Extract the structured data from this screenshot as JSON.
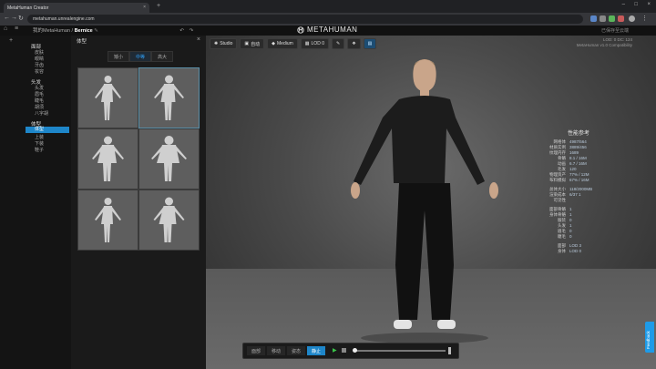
{
  "browser": {
    "tab_title": "MetaHuman Creator",
    "url": "metahuman.unrealengine.com",
    "close_glyph": "×",
    "new_tab_glyph": "+",
    "window_controls": [
      "–",
      "□",
      "×"
    ]
  },
  "header": {
    "breadcrumb_root": "我的MetaHuman",
    "breadcrumb_sep": "/",
    "character_name": "Bernice",
    "logo_text": "METAHUMAN",
    "undo_glyph": "↶",
    "redo_glyph": "↷",
    "right_text": "已保存至云端"
  },
  "leftnav": {
    "groups": [
      {
        "label": "面部",
        "items": [
          "皮肤",
          "眼睛",
          "牙齿",
          "妆容"
        ]
      },
      {
        "label": "头发",
        "items": [
          "头发",
          "眉毛",
          "睫毛",
          "胡须",
          "八字胡"
        ]
      },
      {
        "label": "体型",
        "items": [
          "体型",
          "上装",
          "下装",
          "鞋子"
        ]
      }
    ],
    "active_item": "体型"
  },
  "panel": {
    "title": "体型",
    "close_glyph": "×",
    "segments": [
      "矮小",
      "中等",
      "高大"
    ],
    "active_segment": "中等",
    "thumbnail_count": 6,
    "selected_thumbnail": 1
  },
  "viewport": {
    "toolbar": [
      {
        "icon": "light-icon",
        "label": "Studio"
      },
      {
        "icon": "camera-icon",
        "label": "自动"
      },
      {
        "icon": "quality-icon",
        "label": "Medium"
      },
      {
        "icon": "lod-icon",
        "label": "LOD 0"
      },
      {
        "icon": "pose-icon",
        "label": ""
      },
      {
        "icon": "hair-icon",
        "label": ""
      },
      {
        "icon": "render-icon",
        "label": ""
      }
    ],
    "topright_lines": [
      "LOD: 0  DC: 124",
      "MetaHuman  v1.0  Compatibility"
    ],
    "stats_title": "性能参考",
    "stats": [
      {
        "k": "网格体",
        "v": "4987/564"
      },
      {
        "k": "材质实例",
        "v": "3889/456"
      },
      {
        "k": "纹理内存",
        "v": "1689"
      },
      {
        "k": "骨骼",
        "v": "8.1 / 16M"
      },
      {
        "k": "动画",
        "v": "6.7 / 16M"
      },
      {
        "k": "毛发",
        "v": "120"
      },
      {
        "k": "物理资产",
        "v": "77% / 12M"
      },
      {
        "k": "布料模拟",
        "v": "67% / 16M"
      },
      {
        "k": "",
        "v": ""
      },
      {
        "k": "总体大小",
        "v": "118/2000MB"
      },
      {
        "k": "渲染成本",
        "v": "6/37 1"
      },
      {
        "k": "可见性",
        "v": ""
      },
      {
        "k": "",
        "v": ""
      },
      {
        "k": "面部骨骼",
        "v": "1"
      },
      {
        "k": "身体骨骼",
        "v": "1"
      },
      {
        "k": "服装",
        "v": "0"
      },
      {
        "k": "头发",
        "v": "1"
      },
      {
        "k": "眉毛",
        "v": "0"
      },
      {
        "k": "睫毛",
        "v": "0"
      },
      {
        "k": "",
        "v": ""
      },
      {
        "k": "面部",
        "v": "LOD 3"
      },
      {
        "k": "身体",
        "v": "LOD 0"
      }
    ],
    "bottom_tabs": [
      "面部",
      "移动",
      "姿态",
      "静止"
    ],
    "active_bottom_tab": "静止",
    "play_glyph": "▶",
    "timeline_position": 0.0
  },
  "feedback": {
    "label": "Feedback"
  }
}
